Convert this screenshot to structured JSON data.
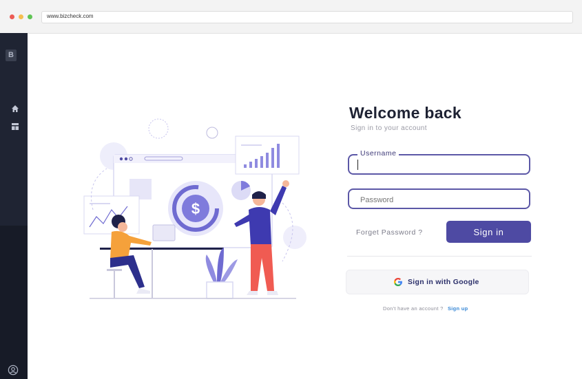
{
  "browser": {
    "url": "www.bizcheck.com",
    "window_controls": {
      "close_color": "#ec5b54",
      "minimize_color": "#f5be4f",
      "maximize_color": "#5fc454"
    }
  },
  "sidebar": {
    "logo_letter": "B",
    "items": [
      {
        "icon": "home-icon"
      },
      {
        "icon": "dashboard-icon"
      }
    ],
    "footer_icon": "user-icon"
  },
  "login": {
    "title": "Welcome back",
    "subtitle": "Sign in to your account",
    "username": {
      "label": "Username",
      "value": ""
    },
    "password": {
      "placeholder": "Password",
      "value": ""
    },
    "forget_password": "Forget Password ?",
    "sign_in_button": "Sign in",
    "google_button": "Sign in with Google",
    "no_account_text": "Don't have an account ?",
    "sign_up_link": "Sign up"
  },
  "illustration": {
    "chart_symbol": "$",
    "icon": "business-analytics-illustration"
  },
  "colors": {
    "accent": "#4e4aa3",
    "sidebar": "#1f2433",
    "link": "#3a89d6"
  }
}
